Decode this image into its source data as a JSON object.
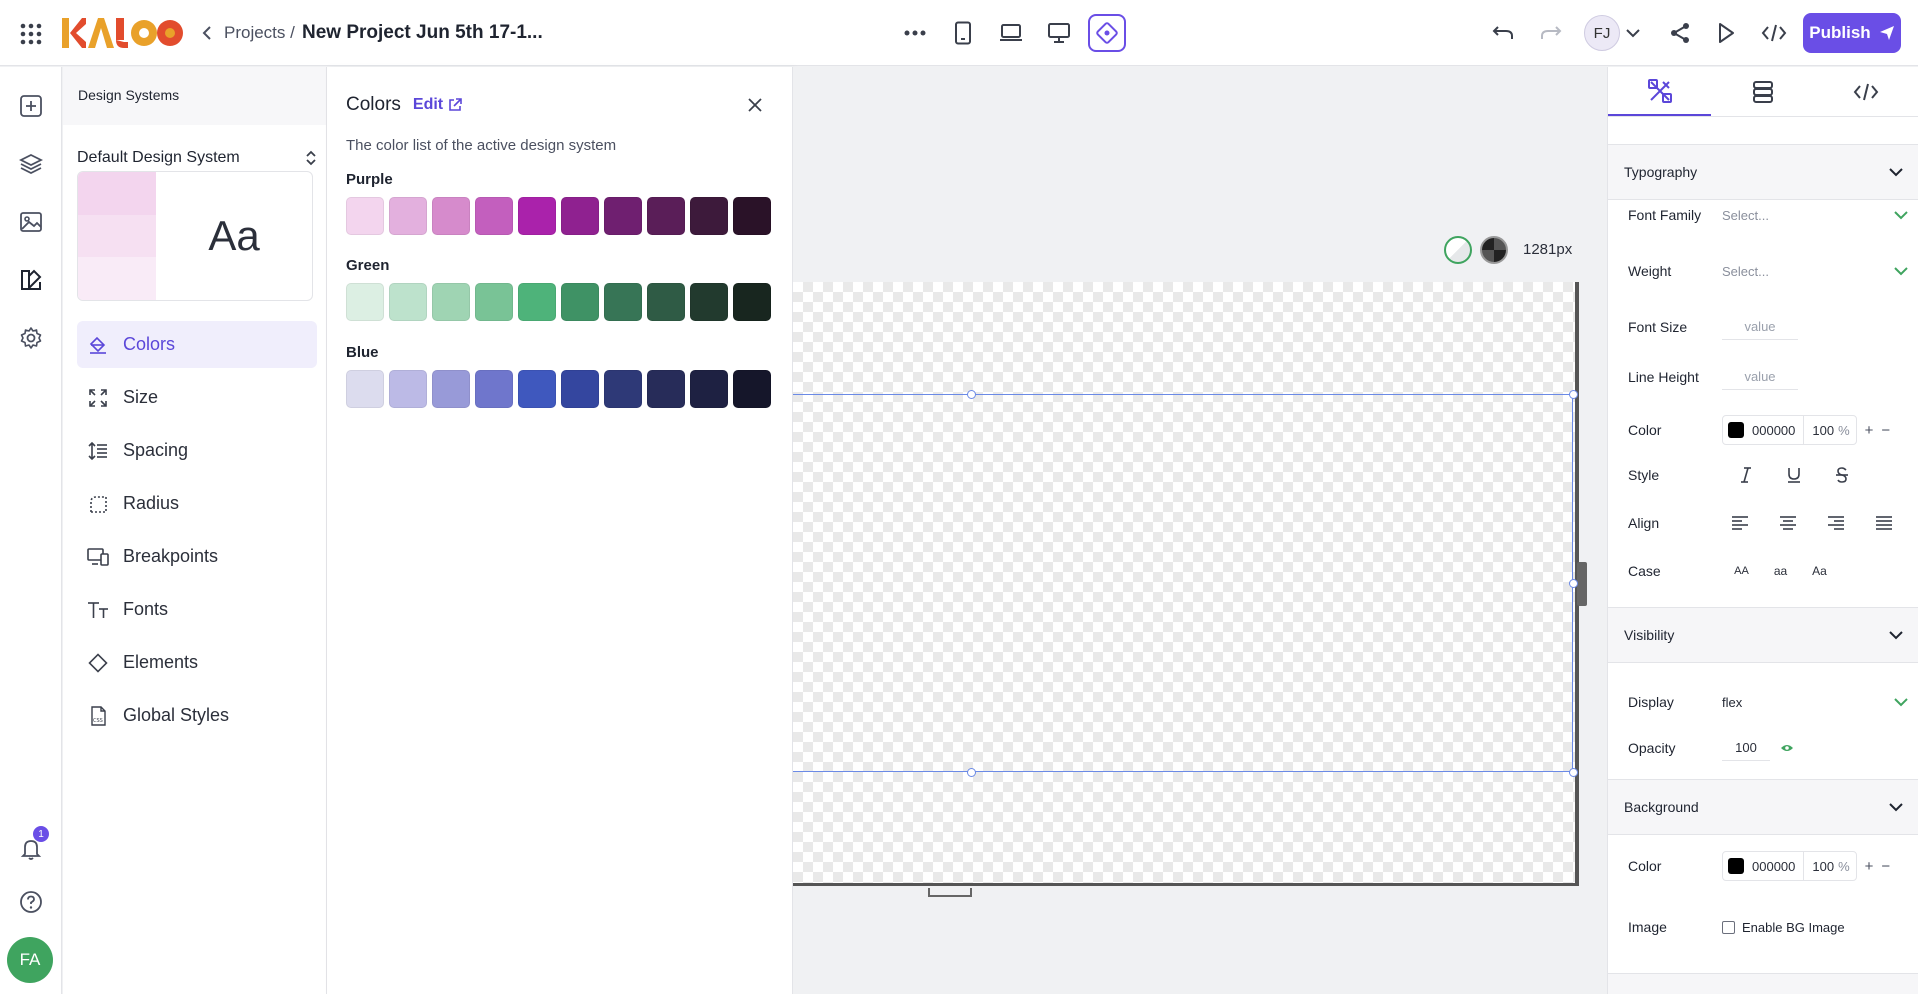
{
  "topbar": {
    "breadcrumb_projects": "Projects /",
    "project_title": "New Project Jun 5th 17-1...",
    "user_initials": "FJ",
    "publish_label": "Publish"
  },
  "rail": {
    "notification_count": "1",
    "user_initials": "FA"
  },
  "design_systems": {
    "header": "Design Systems",
    "selected_system": "Default Design System",
    "preview_text": "Aa",
    "nav": [
      {
        "label": "Colors",
        "icon": "paint-bucket-icon"
      },
      {
        "label": "Size",
        "icon": "expand-icon"
      },
      {
        "label": "Spacing",
        "icon": "line-spacing-icon"
      },
      {
        "label": "Radius",
        "icon": "corner-radius-icon"
      },
      {
        "label": "Breakpoints",
        "icon": "devices-icon"
      },
      {
        "label": "Fonts",
        "icon": "text-font-icon"
      },
      {
        "label": "Elements",
        "icon": "diamond-icon"
      },
      {
        "label": "Global Styles",
        "icon": "css-file-icon"
      }
    ]
  },
  "colors_panel": {
    "title": "Colors",
    "edit_label": "Edit",
    "description": "The color list of the active design system",
    "palettes": [
      {
        "name": "Purple",
        "swatches": [
          "#f3d5ee",
          "#e3b0de",
          "#d68bcc",
          "#c35fbe",
          "#aa22ab",
          "#8f2190",
          "#6f1f70",
          "#5a1e58",
          "#3d1a3b",
          "#2a1228"
        ]
      },
      {
        "name": "Green",
        "swatches": [
          "#dcefe3",
          "#bde2cc",
          "#9fd4b3",
          "#79c396",
          "#4eb37a",
          "#3f9265",
          "#377556",
          "#2f5b45",
          "#223a2e",
          "#18261f"
        ]
      },
      {
        "name": "Blue",
        "swatches": [
          "#dcdcee",
          "#bcbae6",
          "#989ad8",
          "#6f76cc",
          "#3f58be",
          "#34469f",
          "#2e3977",
          "#272c59",
          "#1e2142",
          "#15162a"
        ]
      }
    ]
  },
  "canvas": {
    "width_label": "1281px"
  },
  "properties": {
    "typography": {
      "header": "Typography",
      "font_family_label": "Font Family",
      "font_family_value": "Select...",
      "weight_label": "Weight",
      "weight_value": "Select...",
      "font_size_label": "Font Size",
      "font_size_value": "value",
      "line_height_label": "Line Height",
      "line_height_value": "value",
      "color_label": "Color",
      "color_hex": "000000",
      "color_opacity": "100",
      "percent": "%",
      "style_label": "Style",
      "align_label": "Align",
      "case_label": "Case",
      "case_upper": "AA",
      "case_lower": "aa",
      "case_title": "Aa"
    },
    "visibility": {
      "header": "Visibility",
      "display_label": "Display",
      "display_value": "flex",
      "opacity_label": "Opacity",
      "opacity_value": "100"
    },
    "background": {
      "header": "Background",
      "color_label": "Color",
      "color_hex": "000000",
      "color_opacity": "100",
      "percent": "%",
      "image_label": "Image",
      "enable_bg_image": "Enable BG Image"
    }
  },
  "colors": {
    "accent": "#6a4ee6",
    "avatar_green": "#3fa45f"
  }
}
